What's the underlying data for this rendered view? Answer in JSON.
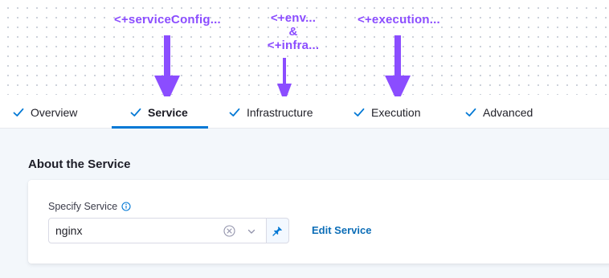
{
  "annotations": {
    "service_config": "<+serviceConfig...",
    "env_line": "<+env...",
    "ampersand": "&",
    "infra_line": "<+infra...",
    "execution": "<+execution..."
  },
  "tabs": [
    {
      "label": "Overview",
      "completed": true,
      "active": false
    },
    {
      "label": "Service",
      "completed": true,
      "active": true
    },
    {
      "label": "Infrastructure",
      "completed": true,
      "active": false
    },
    {
      "label": "Execution",
      "completed": true,
      "active": false
    },
    {
      "label": "Advanced",
      "completed": true,
      "active": false
    }
  ],
  "section": {
    "title": "About the Service",
    "field_label": "Specify Service",
    "service_value": "nginx",
    "edit_link": "Edit Service"
  },
  "colors": {
    "annotation": "#8b4dff",
    "accent": "#0278d5",
    "link": "#0b6db7"
  },
  "icons": {
    "tab_status": "check-icon",
    "field_help": "info-icon",
    "select_clear": "clear-icon",
    "select_open": "chevron-down-icon",
    "pin": "pin-icon"
  }
}
